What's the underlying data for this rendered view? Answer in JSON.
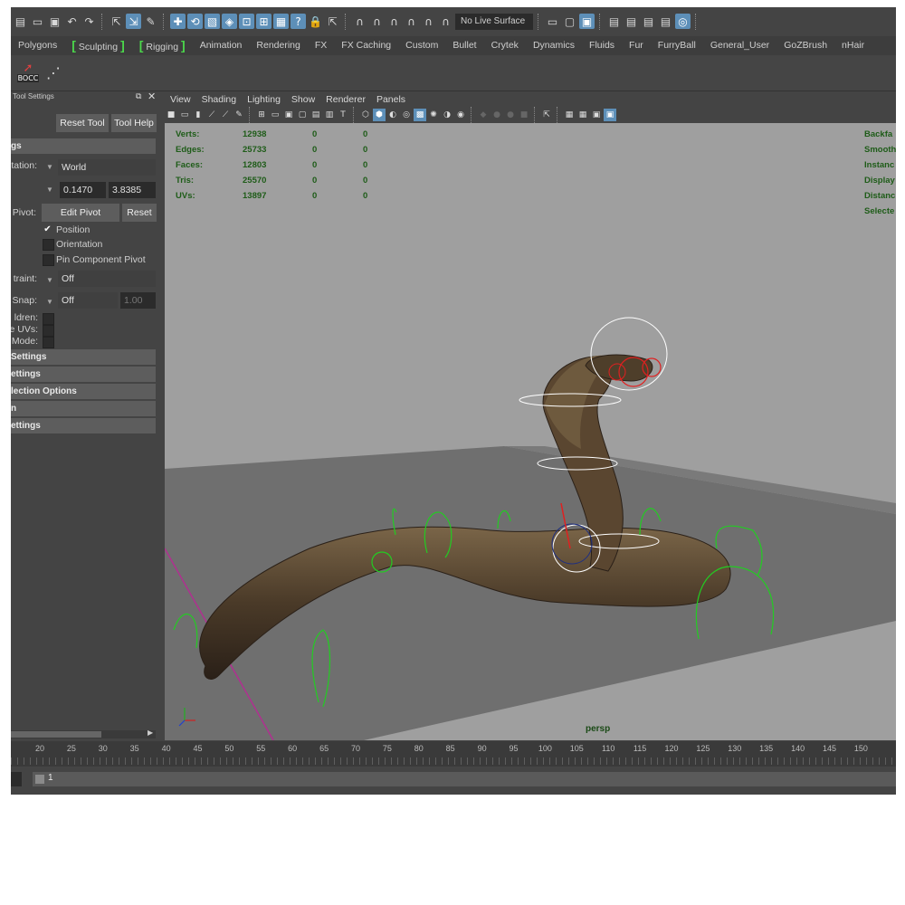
{
  "statusline": {
    "live_surface": "No Live Surface",
    "icons": [
      "new-scene-icon",
      "open-scene-icon",
      "save-scene-icon",
      "undo-icon",
      "redo-icon",
      "select-tool-icon",
      "lasso-icon",
      "paint-select-icon",
      "move-icon",
      "rotate-icon",
      "scale-icon",
      "snap-grid-icon",
      "snap-curve-icon",
      "snap-point-icon",
      "snap-plane-icon",
      "help-icon",
      "lock-icon",
      "pick-icon",
      "magnet-icon",
      "history-icon",
      "input-icon",
      "output-icon",
      "render-icon",
      "ipr-icon",
      "render-settings-icon",
      "hypershade-icon"
    ]
  },
  "shelf_tabs": [
    "Polygons",
    "Sculpting",
    "Rigging",
    "Animation",
    "Rendering",
    "FX",
    "FX Caching",
    "Custom",
    "Bullet",
    "Crytek",
    "Dynamics",
    "Fluids",
    "Fur",
    "FurryBall",
    "General_User",
    "GoZBrush",
    "nHair"
  ],
  "shelf": {
    "bocc_label": "BOCC"
  },
  "tool_settings": {
    "header": "Tool Settings",
    "reset_tool": "Reset Tool",
    "tool_help": "Tool Help",
    "section_top": "gs",
    "orientation_label": "tation:",
    "orientation_value": "World",
    "value1": "0.1470",
    "value2": "3.8385",
    "pivot_label": "Pivot:",
    "edit_pivot": "Edit Pivot",
    "reset": "Reset",
    "position": "Position",
    "orientation": "Orientation",
    "pin_component_pivot": "Pin Component Pivot",
    "constraint_label": "traint:",
    "constraint_value": "Off",
    "snap_label": "Snap:",
    "snap_value": "Off",
    "snap_amount": "1.00",
    "children_label": "ldren:",
    "uvs_label": "e UVs:",
    "mode_label": "Mode:",
    "sections": [
      "Settings",
      "ettings",
      "lection Options",
      "n",
      "ettings"
    ]
  },
  "viewport": {
    "menu": [
      "View",
      "Shading",
      "Lighting",
      "Show",
      "Renderer",
      "Panels"
    ],
    "camera": "persp",
    "hud_stats": [
      {
        "label": "Verts:",
        "v1": "12938",
        "v2": "0",
        "v3": "0"
      },
      {
        "label": "Edges:",
        "v1": "25733",
        "v2": "0",
        "v3": "0"
      },
      {
        "label": "Faces:",
        "v1": "12803",
        "v2": "0",
        "v3": "0"
      },
      {
        "label": "Tris:",
        "v1": "25570",
        "v2": "0",
        "v3": "0"
      },
      {
        "label": "UVs:",
        "v1": "13897",
        "v2": "0",
        "v3": "0"
      }
    ],
    "hud_right": [
      "Backfa",
      "Smooth",
      "Instanc",
      "Display",
      "Distanc",
      "Selecte"
    ],
    "colors": {
      "background": "#9f9f9f",
      "ground": "#6f6f6f",
      "ground_far": "#7a7a7a",
      "controls": "#22cc22",
      "selected_control": "#e02020",
      "hud_text": "#1e5c18",
      "snake_body": "#4a3a28"
    }
  },
  "timeslider": {
    "ticks": [
      "20",
      "25",
      "30",
      "35",
      "40",
      "45",
      "50",
      "55",
      "60",
      "65",
      "70",
      "75",
      "80",
      "85",
      "90",
      "95",
      "100",
      "105",
      "110",
      "115",
      "120",
      "125",
      "130",
      "135",
      "140",
      "145",
      "150"
    ],
    "start_frame": "1"
  }
}
